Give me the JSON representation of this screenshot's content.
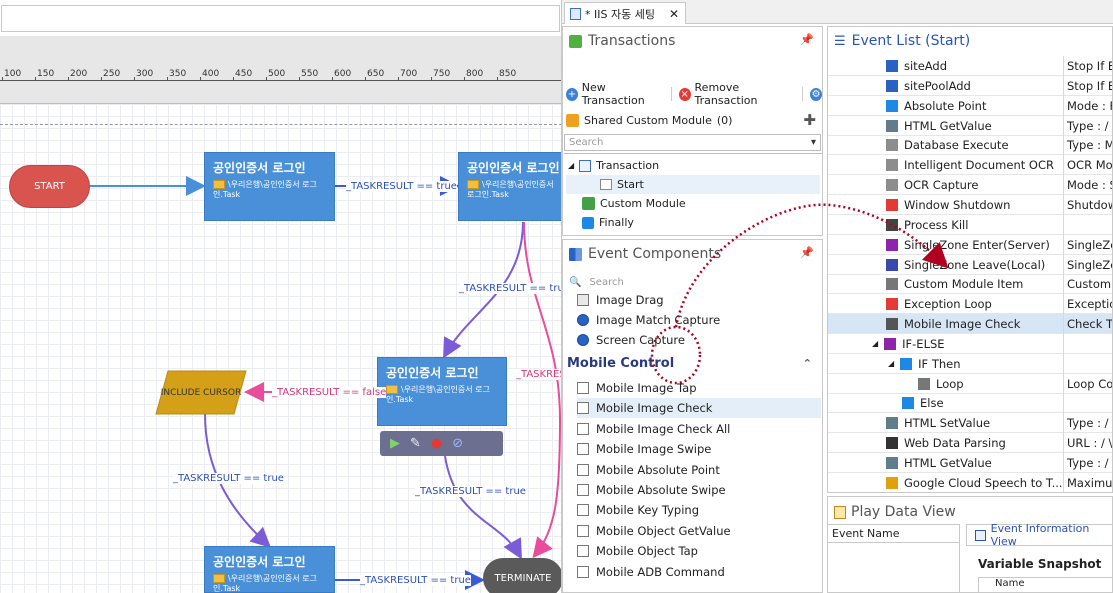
{
  "canvas": {
    "ruler_ticks": [
      "100",
      "150",
      "200",
      "250",
      "300",
      "350",
      "400",
      "450",
      "500",
      "550",
      "600",
      "650",
      "700",
      "750",
      "800",
      "850"
    ],
    "start_label": "START",
    "node_title": "공인인증서 로그인",
    "node_path": "\\우리은행\\공인인증서 로그인.Task",
    "include_label": "INCLUDE CURSOR",
    "terminate_label": "TERMINATE",
    "edge_true": "_TASKRESULT == true",
    "edge_false": "_TASKRESULT == false",
    "edge_partial": "_TASKRES",
    "colors": {
      "node": "#4a90d9",
      "start": "#d9534f",
      "include": "#d4a017",
      "terminate": "#5a5a5a"
    }
  },
  "doc_tab": {
    "title": "* IIS 자동 세팅",
    "close": "✕"
  },
  "transactions": {
    "title": "Transactions",
    "new_btn": "New Transaction",
    "remove_btn": "Remove Transaction",
    "shared_module": "Shared Custom Module",
    "shared_count": "(0)",
    "search_placeholder": "Search",
    "tree": {
      "transaction": "Transaction",
      "start": "Start",
      "custom_module": "Custom Module",
      "finally": "Finally"
    }
  },
  "event_components": {
    "title": "Event Components",
    "search_placeholder": "Search",
    "items_top": [
      "Image Drag",
      "Image Match Capture",
      "Screen Capture"
    ],
    "section": "Mobile Control",
    "mobile_items": [
      "Mobile Image Tap",
      "Mobile Image Check",
      "Mobile Image Check All",
      "Mobile Image Swipe",
      "Mobile Absolute Point",
      "Mobile Absolute Swipe",
      "Mobile Key Typing",
      "Mobile Object GetValue",
      "Mobile Object Tap",
      "Mobile ADB Command"
    ]
  },
  "event_list": {
    "title": "Event List (Start)",
    "rows": [
      {
        "name": "siteAdd",
        "val": "Stop If E"
      },
      {
        "name": "sitePoolAdd",
        "val": "Stop If E"
      },
      {
        "name": "Absolute Point",
        "val": "Mode : F"
      },
      {
        "name": "HTML GetValue",
        "val": "Type :  /"
      },
      {
        "name": "Database Execute",
        "val": "Type : M"
      },
      {
        "name": "Intelligent Document OCR",
        "val": "OCR Mo"
      },
      {
        "name": "OCR Capture",
        "val": "Mode : S"
      },
      {
        "name": "Window Shutdown",
        "val": "Shutdow"
      },
      {
        "name": "Process Kill",
        "val": ""
      },
      {
        "name": "SingleZone Enter(Server)",
        "val": "SingleZo"
      },
      {
        "name": "SingleZone Leave(Local)",
        "val": "SingleZo"
      },
      {
        "name": "Custom Module Item",
        "val": "Custom I"
      },
      {
        "name": "Exception Loop",
        "val": "Exception"
      },
      {
        "name": "Mobile Image Check",
        "val": "Check Ty"
      },
      {
        "name": "IF-ELSE",
        "val": ""
      },
      {
        "name": "IF Then",
        "val": ""
      },
      {
        "name": "Loop",
        "val": "Loop Co"
      },
      {
        "name": "Else",
        "val": ""
      },
      {
        "name": "HTML SetValue",
        "val": "Type :  /"
      },
      {
        "name": "Web Data Parsing",
        "val": "URL : / \\"
      },
      {
        "name": "HTML GetValue",
        "val": "Type :  /"
      },
      {
        "name": "Google Cloud Speech to T...",
        "val": "Maximur"
      }
    ]
  },
  "play_data": {
    "title": "Play Data View",
    "event_name_col": "Event Name",
    "event_info_tab": "Event Information View",
    "variable_snapshot": "Variable Snapshot",
    "name_col": "Name"
  }
}
